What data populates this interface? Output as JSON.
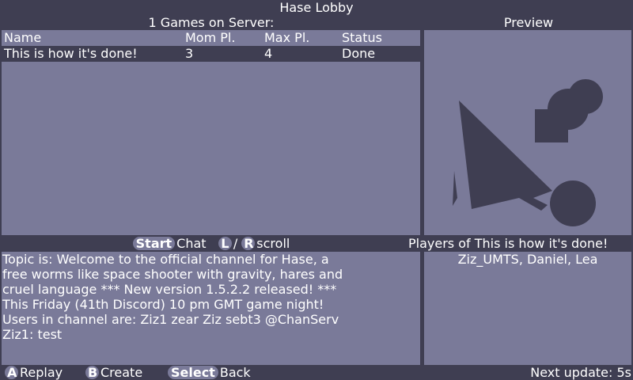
{
  "window": {
    "title": "Hase Lobby"
  },
  "games": {
    "count_label": "1 Games on Server:",
    "columns": [
      "Name",
      "Mom Pl.",
      "Max Pl.",
      "Status"
    ],
    "rows": [
      {
        "name": "This is how it's done!",
        "mom": "3",
        "max": "4",
        "status": "Done"
      }
    ]
  },
  "preview": {
    "label": "Preview"
  },
  "chat": {
    "start_button": "Start",
    "chat_label": "Chat",
    "l_button": "L",
    "slash": "/",
    "r_button": "R",
    "scroll_label": "scroll",
    "lines": [
      "Topic is: Welcome to the official channel for Hase, a",
      "free worms like space shooter with gravity, hares and",
      "cruel language *** New version 1.5.2.2 released! ***",
      "This Friday (41th Discord) 10 pm GMT game night!",
      "Users in channel are: Ziz1 zear Ziz sebt3 @ChanServ",
      "Ziz1: test"
    ]
  },
  "players": {
    "label": "Players of This is how it's done!",
    "list": "Ziz_UMTS, Daniel, Lea"
  },
  "footer": {
    "a_button": "A",
    "replay_label": "Replay",
    "b_button": "B",
    "create_label": "Create",
    "select_button": "Select",
    "back_label": "Back",
    "next_update": "Next update: 5s"
  },
  "colors": {
    "background": "#3f3e52",
    "panel": "#7a7a99",
    "text": "#ffffff"
  }
}
